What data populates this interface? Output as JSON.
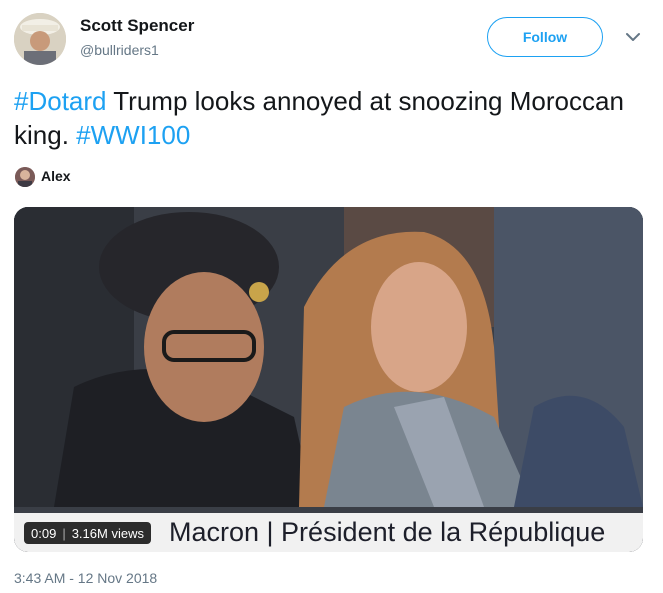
{
  "author": {
    "name": "Scott Spencer",
    "handle": "@bullriders1"
  },
  "follow_label": "Follow",
  "tweet": {
    "hashtag1": "#Dotard",
    "text1": " Trump looks annoyed at snoozing Moroccan king. ",
    "hashtag2": "#WWI100"
  },
  "credit_name": "Alex",
  "media": {
    "caption": "Macron | Président de la République",
    "time": "0:09",
    "views": "3.16M views"
  },
  "timestamp": "3:43 AM - 12 Nov 2018",
  "colors": {
    "accent": "#1da1f2",
    "secondary_text": "#657786"
  }
}
